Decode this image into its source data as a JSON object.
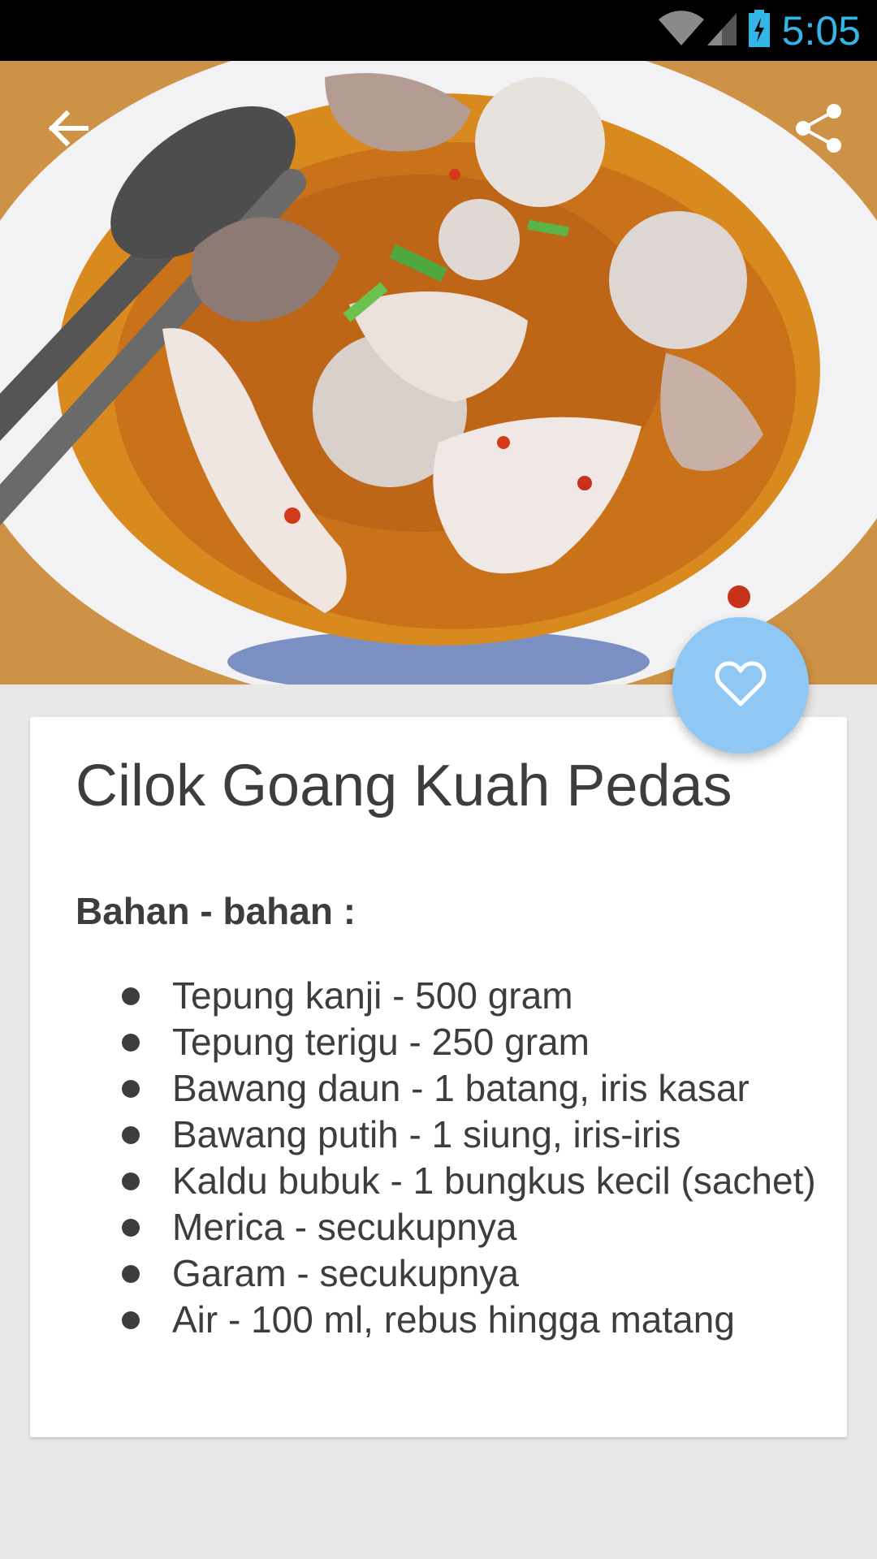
{
  "status_bar": {
    "time": "5:05",
    "icons": [
      "wifi-icon",
      "signal-icon",
      "battery-charging-icon"
    ]
  },
  "toolbar": {
    "back_icon": "arrow-back-icon",
    "share_icon": "share-icon"
  },
  "hero": {
    "icon": "food-photo"
  },
  "fab": {
    "icon": "heart-outline-icon"
  },
  "recipe": {
    "title": "Cilok Goang Kuah Pedas",
    "ingredients_heading": "Bahan - bahan :",
    "ingredients": [
      "Tepung kanji - 500 gram",
      "Tepung terigu - 250 gram",
      "Bawang daun - 1 batang, iris kasar",
      "Bawang putih - 1 siung, iris-iris",
      "Kaldu bubuk - 1 bungkus kecil (sachet)",
      "Merica - secukupnya",
      "Garam - secukupnya",
      "Air - 100 ml, rebus hingga matang"
    ]
  },
  "colors": {
    "status_time": "#33b5e5",
    "fab": "#90c8f5",
    "text": "#3d3d3d",
    "background": "#e8e8e8"
  }
}
